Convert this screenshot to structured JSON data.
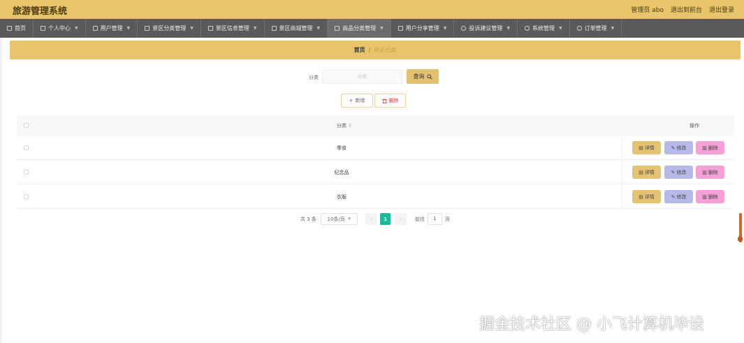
{
  "app": {
    "title": "旅游管理系统",
    "admin_label": "管理员 abo",
    "frontend_link": "退出到前台",
    "logout_link": "退出登录"
  },
  "nav": {
    "items": [
      {
        "label": "首页",
        "icon": "home-icon",
        "has_dropdown": false
      },
      {
        "label": "个人中心",
        "icon": "user-icon",
        "has_dropdown": true
      },
      {
        "label": "用户管理",
        "icon": "list-icon",
        "has_dropdown": true
      },
      {
        "label": "景区分类管理",
        "icon": "list-icon",
        "has_dropdown": true
      },
      {
        "label": "景区信息管理",
        "icon": "building-icon",
        "has_dropdown": true
      },
      {
        "label": "景区商城管理",
        "icon": "location-icon",
        "has_dropdown": true
      },
      {
        "label": "商品分类管理",
        "icon": "trash-icon",
        "has_dropdown": true
      },
      {
        "label": "用户分享管理",
        "icon": "grid-icon",
        "has_dropdown": true
      },
      {
        "label": "投诉建议管理",
        "icon": "clock-icon",
        "has_dropdown": true
      },
      {
        "label": "系统管理",
        "icon": "clock-icon",
        "has_dropdown": true
      },
      {
        "label": "订单管理",
        "icon": "clock-icon",
        "has_dropdown": true
      }
    ]
  },
  "breadcrumb": {
    "home": "首页",
    "separator": "/",
    "current": "商品分类"
  },
  "search": {
    "label": "分类",
    "placeholder": "分类",
    "button_label": "查询"
  },
  "actions": {
    "add_label": "新增",
    "delete_label": "删除"
  },
  "table": {
    "headers": {
      "category": "分类",
      "operations": "操作"
    },
    "rows": [
      {
        "category": "零食"
      },
      {
        "category": "纪念品"
      },
      {
        "category": "衣服"
      }
    ],
    "row_actions": {
      "detail": "详情",
      "edit": "修改",
      "delete": "删除"
    }
  },
  "pagination": {
    "total_text": "共 3 条",
    "page_size": "10条/页",
    "current_page": "1",
    "goto_label": "前往",
    "goto_value": "1",
    "page_suffix": "页"
  },
  "watermark": "掘金技术社区 @ 小飞计算机毕设",
  "colors": {
    "accent": "#e8c46a",
    "nav_bg": "#5a5a5a",
    "detail_btn": "#e6c373",
    "edit_btn": "#b7b9e8",
    "delete_btn": "#f5a0d6",
    "page_active": "#1fb99a"
  }
}
